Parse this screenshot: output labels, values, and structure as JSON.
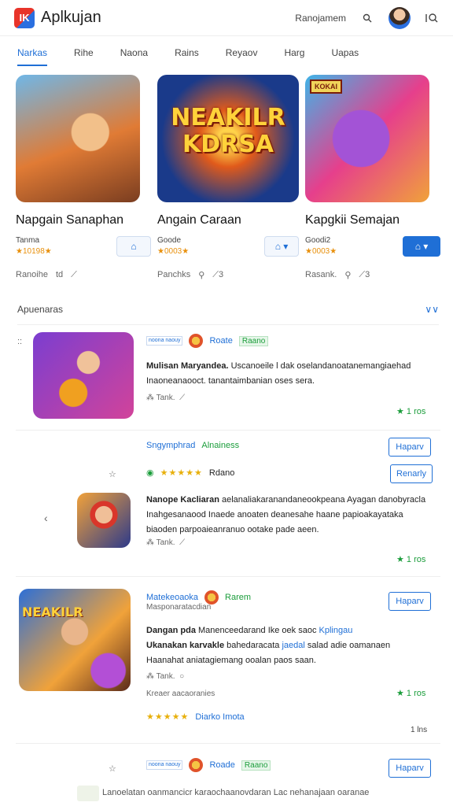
{
  "header": {
    "logo_text": "IK",
    "app_title": "Aplkujan",
    "user_label": "Ranojamem",
    "search_icon": "search-icon",
    "settings_icon": "settings-icon"
  },
  "tabs": [
    {
      "label": "Narkas",
      "active": true
    },
    {
      "label": "Rihe",
      "active": false
    },
    {
      "label": "Naona",
      "active": false
    },
    {
      "label": "Rains",
      "active": false
    },
    {
      "label": "Reyaov",
      "active": false
    },
    {
      "label": "Harg",
      "active": false
    },
    {
      "label": "Uapas",
      "active": false
    }
  ],
  "featured": [
    {
      "image_text": "",
      "name": "Napgain Sanaphan",
      "sub": "Tanma",
      "rating": "★10198★",
      "button": "⌂",
      "stats_left": "Ranoihe",
      "stats_mid": "td",
      "stats_right": "⟋"
    },
    {
      "image_text": "NEAKILR KDRSA",
      "name": "Angain Caraan",
      "sub": "Goode",
      "rating": "★0003★",
      "button": "⌂ ▾",
      "stats_left": "Panchks",
      "stats_mid": "⚲",
      "stats_right": "⟋3"
    },
    {
      "image_text": "",
      "badge": "KOKAI",
      "name": "Kapgkii Semajan",
      "sub": "Goodi2",
      "rating": "★0003★",
      "button": "⌂ ▾",
      "stats_left": "Rasank.",
      "stats_mid": "⚲",
      "stats_right": "⟋3"
    }
  ],
  "section": {
    "title": "Apuenaras",
    "chevron": "∨∨"
  },
  "items": [
    {
      "tag": "noona naouy",
      "dev": "Roate",
      "green": "Raano",
      "title": "Mulisan Maryandea.",
      "desc1": "Uscanoeile l dak oselandanoatanemangiaehad",
      "desc2": "Inaoneanaooct. tanantaimbanian oses sera.",
      "stats": "Tank.",
      "score": "1 ros",
      "side": "::"
    },
    {
      "heading": "Sngymphrad",
      "heading_sub": "Alnainess",
      "btn_top": "Haparv",
      "btn2": "Renarly",
      "rating_label": "Rdano",
      "title": "Nanope Kacliaran",
      "desc1": "aelanaliakaranandaneookpeana Ayagan danobyracla",
      "desc2": "Inahgesanaood Inaede anoaten deanesahe haane papioakayataka",
      "desc3": "biaoden parpoaieanranuo ootake pade aeen.",
      "stats": "Tank.",
      "score": "1 ros",
      "side": "☆"
    },
    {
      "heading": "Matekeoaoka",
      "heading_sub": "Rarem",
      "sub_heading": "Masponaratacdian",
      "btn": "Haparv",
      "title": "Dangan pda",
      "desc1": "Manenceedarand Ike oek saoc",
      "desc1_link": "Kplingau",
      "desc2_bold": "Ukanakan karvakle",
      "desc2": "bahedaracata",
      "desc2_link": "jaedal",
      "desc2_end": "salad adie oamanaen",
      "desc3": "Haanahat aniatagiemang ooalan paos saan.",
      "stats": "Tank.",
      "footer_small": "Kreaer aacaoranies",
      "score": "1 ros",
      "stars_label": "Diarko Imota",
      "page": "1 lns",
      "image_text": "NEAKILR"
    },
    {
      "tag": "noona naouy",
      "dev": "Roade",
      "green": "Raano",
      "btn": "Haparv",
      "footer": "Lanoelatan oanmancicr karaochaanovdaran Lac nehanajaan oaranae",
      "side": "☆"
    }
  ]
}
